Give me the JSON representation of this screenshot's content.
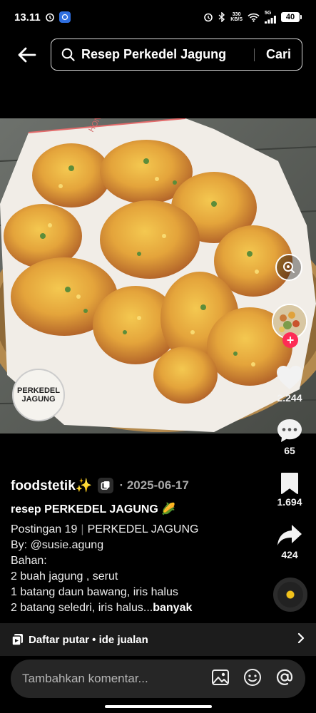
{
  "status_bar": {
    "time": "13.11",
    "speed_value": "330",
    "speed_unit": "KB/S",
    "network": "5G",
    "battery": "40",
    "icons": [
      "alarm-icon",
      "app-notification-icon",
      "alarm-icon",
      "bluetooth-icon",
      "wifi-icon",
      "signal-icon",
      "battery-icon"
    ]
  },
  "header": {
    "search_query": "Resep Perkedel Jagung",
    "search_button": "Cari"
  },
  "media": {
    "watermark_line1": "PERKEDEL",
    "watermark_line2": "JAGUNG",
    "paper_brand": "HONEY"
  },
  "actions": {
    "likes": "2.244",
    "comments": "65",
    "saves": "1.694",
    "shares": "424"
  },
  "caption": {
    "author": "foodstetik✨",
    "date": "· 2025-06-17",
    "title": "resep PERKEDEL JAGUNG 🌽",
    "post_label": "Postingan 19",
    "post_series": "PERKEDEL JAGUNG",
    "lines": [
      "By: @susie.agung",
      "Bahan:",
      "2 buah jagung , serut",
      "1 batang daun bawang, iris halus"
    ],
    "last_line": "2 batang seledri, iris halus...",
    "more": "banyak"
  },
  "playlist": {
    "label": "Daftar putar • ide jualan"
  },
  "comment": {
    "placeholder": "Tambahkan komentar..."
  },
  "colors": {
    "like_accent": "#fe2c55",
    "background": "#000000",
    "search_border": "#d8d8d8"
  }
}
